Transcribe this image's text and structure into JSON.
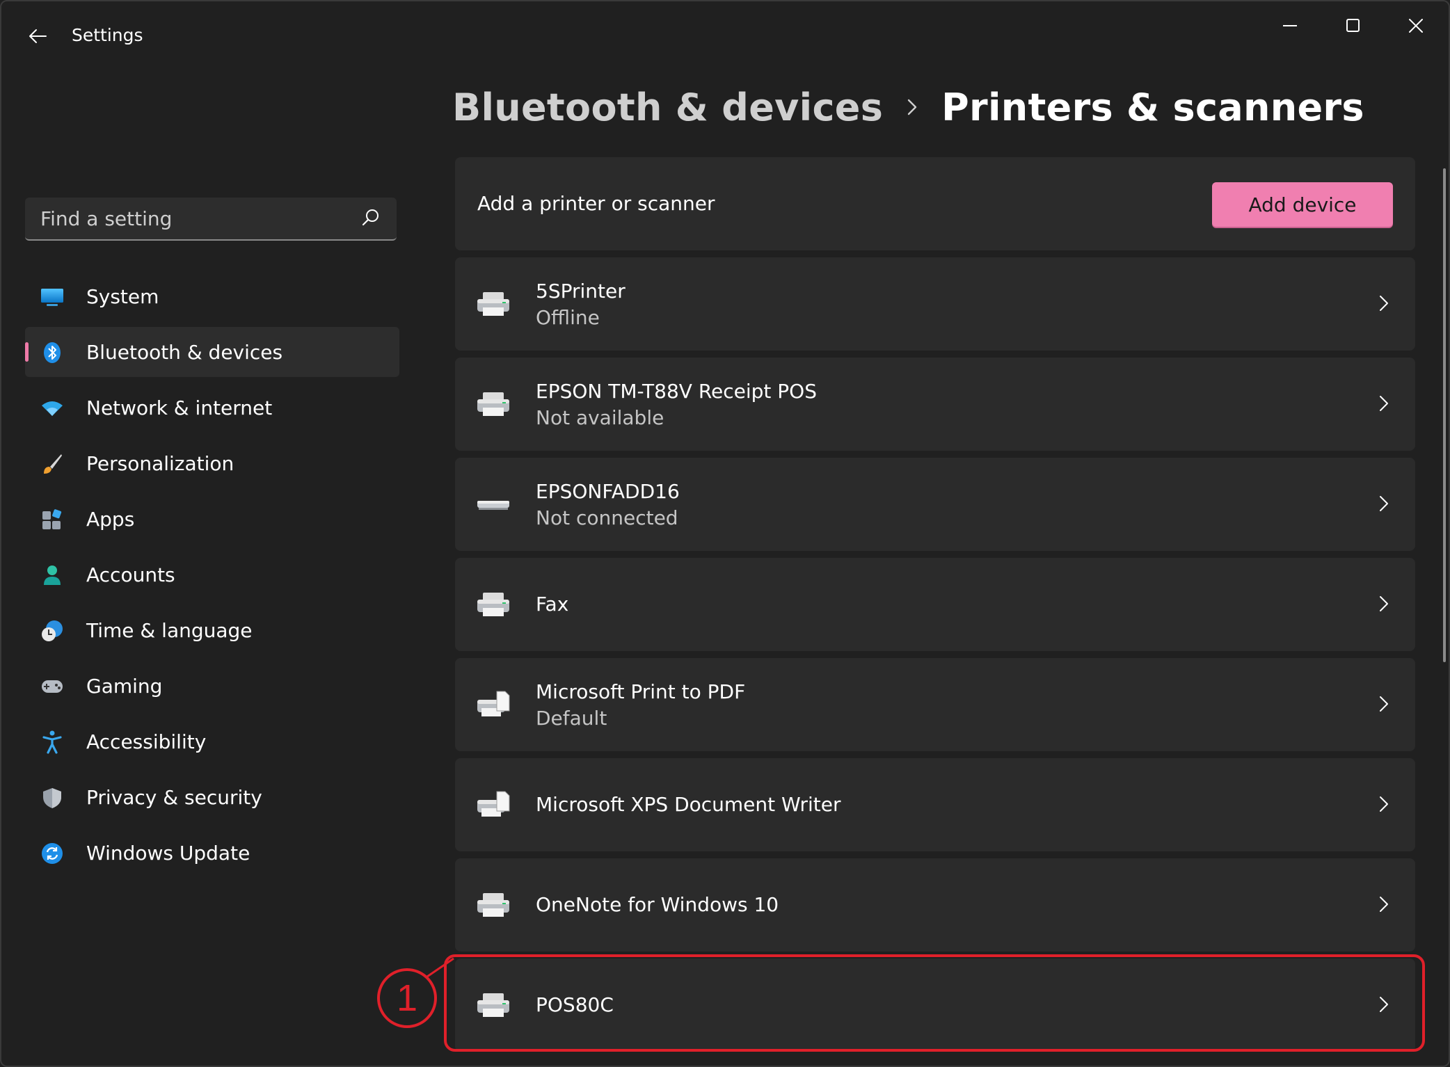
{
  "app": {
    "title": "Settings"
  },
  "search": {
    "placeholder": "Find a setting"
  },
  "sidebar": {
    "items": [
      {
        "label": "System",
        "icon": "monitor-icon",
        "active": false
      },
      {
        "label": "Bluetooth & devices",
        "icon": "bluetooth-icon",
        "active": true
      },
      {
        "label": "Network & internet",
        "icon": "wifi-icon",
        "active": false
      },
      {
        "label": "Personalization",
        "icon": "brush-icon",
        "active": false
      },
      {
        "label": "Apps",
        "icon": "apps-icon",
        "active": false
      },
      {
        "label": "Accounts",
        "icon": "person-icon",
        "active": false
      },
      {
        "label": "Time & language",
        "icon": "clock-globe-icon",
        "active": false
      },
      {
        "label": "Gaming",
        "icon": "gamepad-icon",
        "active": false
      },
      {
        "label": "Accessibility",
        "icon": "accessibility-icon",
        "active": false
      },
      {
        "label": "Privacy & security",
        "icon": "shield-icon",
        "active": false
      },
      {
        "label": "Windows Update",
        "icon": "refresh-icon",
        "active": false
      }
    ]
  },
  "breadcrumb": {
    "parent": "Bluetooth & devices",
    "current": "Printers & scanners"
  },
  "add_section": {
    "label": "Add a printer or scanner",
    "button": "Add device"
  },
  "devices": [
    {
      "name": "5SPrinter",
      "status": "Offline",
      "icon": "printer-icon"
    },
    {
      "name": "EPSON TM-T88V Receipt POS",
      "status": "Not available",
      "icon": "printer-icon"
    },
    {
      "name": "EPSONFADD16",
      "status": "Not connected",
      "icon": "scanner-icon"
    },
    {
      "name": "Fax",
      "status": "",
      "icon": "printer-icon"
    },
    {
      "name": "Microsoft Print to PDF",
      "status": "Default",
      "icon": "pdf-printer-icon"
    },
    {
      "name": "Microsoft XPS Document Writer",
      "status": "",
      "icon": "pdf-printer-icon"
    },
    {
      "name": "OneNote for Windows 10",
      "status": "",
      "icon": "printer-icon"
    },
    {
      "name": "POS80C",
      "status": "",
      "icon": "printer-icon"
    }
  ],
  "annotation": {
    "step": "1"
  },
  "colors": {
    "accent": "#f07fb0",
    "annotation": "#e0202a",
    "background": "#202020",
    "card": "#2b2b2b"
  }
}
